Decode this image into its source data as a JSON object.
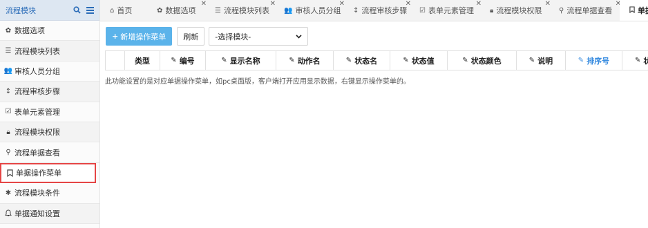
{
  "sidebar": {
    "title": "流程模块",
    "items": [
      {
        "label": "数据选项",
        "icon": "gear-icon"
      },
      {
        "label": "流程模块列表",
        "icon": "list-icon"
      },
      {
        "label": "审核人员分组",
        "icon": "users-icon"
      },
      {
        "label": "流程审核步骤",
        "icon": "sort-icon"
      },
      {
        "label": "表单元素管理",
        "icon": "check-square-icon"
      },
      {
        "label": "流程模块权限",
        "icon": "lock-icon"
      },
      {
        "label": "流程单据查看",
        "icon": "search-icon"
      },
      {
        "label": "单据操作菜单",
        "icon": "bookmark-icon"
      },
      {
        "label": "流程模块条件",
        "icon": "asterisk-icon"
      },
      {
        "label": "单据通知设置",
        "icon": "bell-icon"
      }
    ]
  },
  "tabs": [
    {
      "label": "首页",
      "icon": "home-icon"
    },
    {
      "label": "数据选项",
      "icon": "gear-icon"
    },
    {
      "label": "流程模块列表",
      "icon": "list-icon"
    },
    {
      "label": "审核人员分组",
      "icon": "users-icon"
    },
    {
      "label": "流程审核步骤",
      "icon": "sort-icon"
    },
    {
      "label": "表单元素管理",
      "icon": "check-square-icon"
    },
    {
      "label": "流程模块权限",
      "icon": "lock-icon"
    },
    {
      "label": "流程单据查看",
      "icon": "search-icon"
    },
    {
      "label": "单据操",
      "icon": "bookmark-icon"
    }
  ],
  "toolbar": {
    "add_label": "新增操作菜单",
    "refresh_label": "刷新",
    "select_value": "-选择模块-"
  },
  "table": {
    "columns": [
      "类型",
      "编号",
      "显示名称",
      "动作名",
      "状态名",
      "状态值",
      "状态颜色",
      "说明",
      "排序号",
      "状"
    ]
  },
  "info_text": "此功能设置的是对应单据操作菜单，如pc桌面版，客户端打开应用显示数据，右键显示操作菜单的。",
  "colors": {
    "accent": "#5bb3ea",
    "sidebar_header": "#dde7f2",
    "highlight": "#e54545",
    "sort_column": "#3a8de0"
  }
}
